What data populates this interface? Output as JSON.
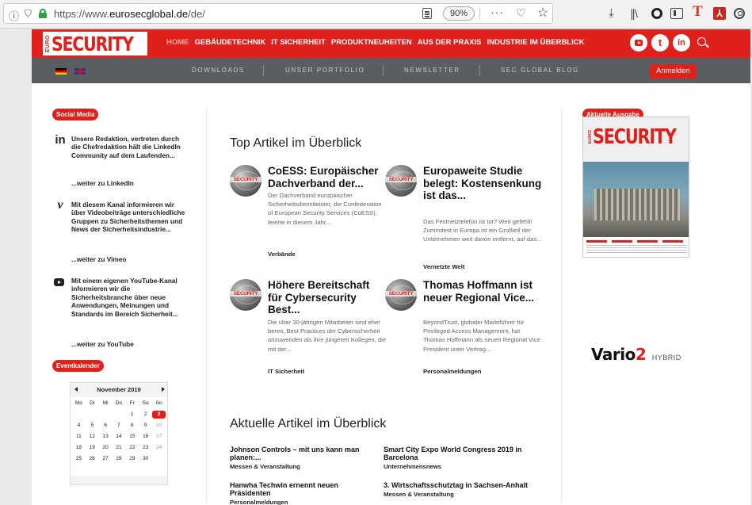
{
  "browser": {
    "url_prefix": "https://www.",
    "url_domain": "eurosecglobal.de",
    "url_path": "/de/",
    "zoom": "90%",
    "more": "···"
  },
  "site": {
    "logo_euro": "EURO",
    "logo_word": "SECURITY",
    "nav": [
      "HOME",
      "GEBÄUDETECHNIK",
      "IT SICHERHEIT",
      "PRODUKTNEUHEITEN",
      "AUS DER PRAXIS",
      "INDUSTRIE IM ÜBERBLICK"
    ],
    "social": {
      "twitter": "t",
      "linkedin": "in"
    },
    "subnav": [
      "DOWNLOADS",
      "UNSER PORTFOLIO",
      "NEWSLETTER",
      "SEC GLOBAL BLOG"
    ],
    "login": "Anmelden"
  },
  "left": {
    "social_badge": "Social Media",
    "items": [
      {
        "icon": "in",
        "text": "Unsere Redaktion, vertreten durch die Chefredaktion hält die LinkedIn Community auf dem Laufenden...",
        "link": "...weiter zu LinkedIn"
      },
      {
        "icon": "v",
        "text": "Mit diesem Kanal informieren wir über Videobeiträge unterschiedliche Gruppen zu Sicherheitsthemen und News der Sicherheitsindustrie...",
        "link": "...weiter zu Vimeo"
      },
      {
        "icon": "",
        "text": "Mit einem eigenen YouTube-Kanal informieren wir die Sicherheitsbranche über neue Anwendungen, Meinungen und Standards im Bereich Sicherheit...",
        "link": "...weiter zu YouTube"
      }
    ],
    "event_badge": "Eventkalender",
    "calendar": {
      "title": "November 2019",
      "weekdays": [
        "Mo",
        "Di",
        "Mi",
        "Do",
        "Fr",
        "Sa",
        "So"
      ],
      "weeks": [
        [
          "",
          "",
          "",
          "",
          "1",
          "2",
          "3"
        ],
        [
          "4",
          "5",
          "6",
          "7",
          "8",
          "9",
          "10"
        ],
        [
          "11",
          "12",
          "13",
          "14",
          "15",
          "16",
          "17"
        ],
        [
          "18",
          "19",
          "20",
          "21",
          "22",
          "23",
          "24"
        ],
        [
          "25",
          "26",
          "27",
          "28",
          "29",
          "30",
          ""
        ]
      ],
      "today": "3"
    }
  },
  "main": {
    "top_title": "Top Artikel im Überblick",
    "thumb_label": "SECURITY",
    "top_articles": [
      {
        "title": "CoESS: Europäischer Dachverband der...",
        "excerpt": "Der Dachverband europäischer Sicherheitsdienstleister, die Confederation of European Security Services (CoESS), feierte in diesem Jahr...",
        "category": "Verbände"
      },
      {
        "title": "Europaweite Studie belegt: Kostensenkung ist das...",
        "excerpt": "Das Festnetztelefon ist tot? Weit gefehlt! Zumindest in Europa ist ein Großteil der Unternehmen weit davon entfernt, auf das...",
        "category": "Vernetzte Welt"
      },
      {
        "title": "Höhere Bereitschaft für Cybersecurity Best...",
        "excerpt": "Die über 30-jährigen Mitarbeiter sind eher bereit, Best Practices der Cybersicherheit anzuwenden als ihre jüngeren Kollegen, die mit der...",
        "category": "IT Sicherheit"
      },
      {
        "title": "Thomas Hoffmann ist neuer Regional Vice...",
        "excerpt": "BeyondTrust, globaler Marktführer für Privileged Access Management, hat Thomas Hoffmann als neuen Regional Vice President unter Vertrag...",
        "category": "Personalmeldungen"
      }
    ],
    "current_title": "Aktuelle Artikel im Überblick",
    "current_articles": [
      {
        "title": "Johnson Controls – mit uns kann man planen:...",
        "category": "Messen & Veranstaltung"
      },
      {
        "title": "Smart City Expo World Congress 2019 in Barcelona",
        "category": "Unternehmensnews"
      },
      {
        "title": "Hanwha Techwin ernennt neuen Präsidenten",
        "category": "Personalmeldungen"
      },
      {
        "title": "3. Wirtschaftsschutztag in Sachsen-Anhalt",
        "category": "Messen & Veranstaltung"
      }
    ]
  },
  "right": {
    "badge": "Aktuelle Ausgabe",
    "mag_euro": "EURO",
    "mag_word": "SECURITY",
    "sponsor_main_a": "Vario",
    "sponsor_main_b": "2",
    "sponsor_sub": "HYBRID"
  },
  "colors": {
    "brand_red": "#e0201b",
    "subbar": "#5a5e63"
  }
}
